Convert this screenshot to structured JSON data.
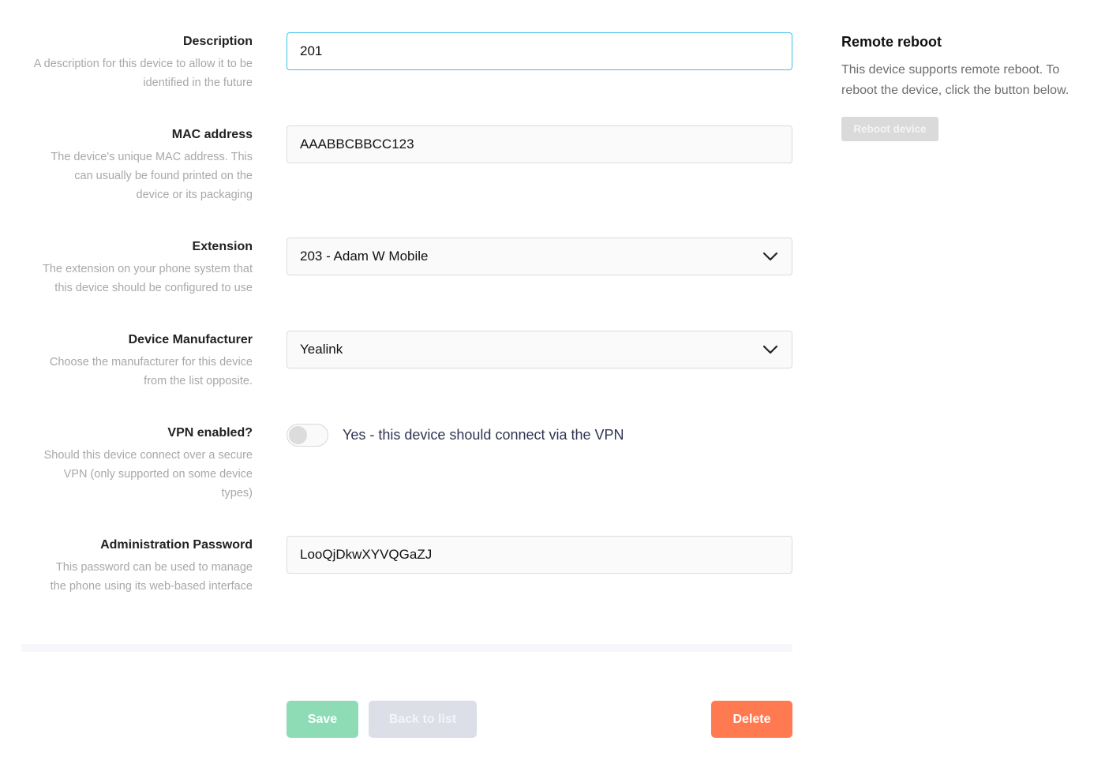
{
  "form": {
    "description": {
      "title": "Description",
      "help": "A description for this device to allow it to be identified in the future",
      "value": "201"
    },
    "mac": {
      "title": "MAC address",
      "help": "The device's unique MAC address. This can usually be found printed on the device or its packaging",
      "value": "AAABBCBBCC123"
    },
    "extension": {
      "title": "Extension",
      "help": "The extension on your phone system that this device should be configured to use",
      "selected": "203 - Adam W Mobile",
      "icon": "chevron-down-icon"
    },
    "manufacturer": {
      "title": "Device Manufacturer",
      "help": "Choose the manufacturer for this device from the list opposite.",
      "selected": "Yealink",
      "icon": "chevron-down-icon"
    },
    "vpn": {
      "title": "VPN enabled?",
      "help": "Should this device connect over a secure VPN (only supported on some device types)",
      "toggle_label": "Yes - this device should connect via the VPN",
      "enabled": false
    },
    "admin_password": {
      "title": "Administration Password",
      "help": "This password can be used to manage the phone using its web-based interface",
      "value": "LooQjDkwXYVQGaZJ"
    }
  },
  "actions": {
    "save_label": "Save",
    "back_label": "Back to list",
    "delete_label": "Delete"
  },
  "sidebar": {
    "title": "Remote reboot",
    "text": "This device supports remote reboot. To reboot the device, click the button below.",
    "reboot_label": "Reboot device"
  },
  "colors": {
    "focus_border": "#3fc1e6",
    "save": "#8ddcb6",
    "back": "#dcdee8",
    "delete": "#ff7a50",
    "reboot_disabled": "#dadada"
  }
}
